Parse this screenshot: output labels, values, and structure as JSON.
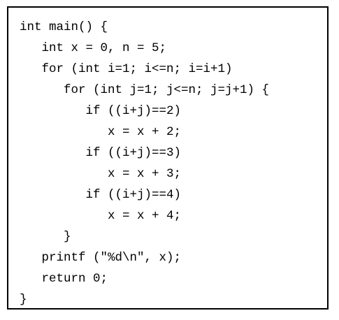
{
  "code": {
    "lines": [
      "int main() {",
      "   int x = 0, n = 5;",
      "   for (int i=1; i<=n; i=i+1)",
      "      for (int j=1; j<=n; j=j+1) {",
      "         if ((i+j)==2)",
      "            x = x + 2;",
      "         if ((i+j)==3)",
      "            x = x + 3;",
      "         if ((i+j)==4)",
      "            x = x + 4;",
      "      }",
      "   printf (\"%d\\n\", x);",
      "   return 0;",
      "}"
    ]
  }
}
